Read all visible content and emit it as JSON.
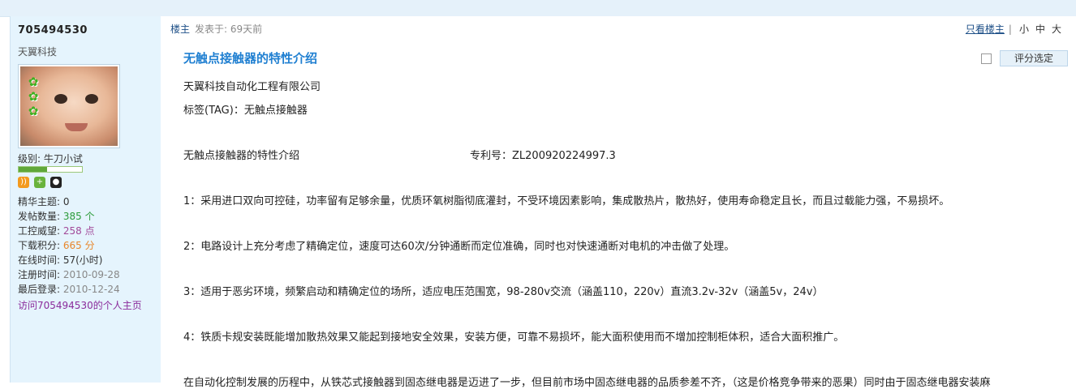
{
  "author": {
    "username": "705494530",
    "title": "天翼科技",
    "level_label": "级别: 牛刀小试",
    "level_progress_fraction": 0.45,
    "icons": [
      "rss-icon",
      "add-friend-icon",
      "qq-icon"
    ],
    "stats": [
      {
        "key": "精华主题: ",
        "value": "0",
        "color": "dark"
      },
      {
        "key": "发帖数量: ",
        "value": "385 个",
        "color": "green"
      },
      {
        "key": "工控威望: ",
        "value": "258 点",
        "color": "purple"
      },
      {
        "key": "下载积分: ",
        "value": "665 分",
        "color": "orange"
      },
      {
        "key": "在线时间: ",
        "value": "57(小时)",
        "color": "dark"
      },
      {
        "key": "注册时间: ",
        "value": "2010-09-28",
        "color": "gray"
      },
      {
        "key": "最后登录: ",
        "value": "2010-12-24",
        "color": "gray"
      }
    ],
    "homepage_link": "访问705494530的个人主页"
  },
  "post": {
    "floor": "楼主",
    "time": "发表于: 69天前",
    "view_only_author": "只看楼主",
    "font_small": "小",
    "font_medium": "中",
    "font_large": "大",
    "title": "无触点接触器的特性介绍",
    "rate_button": "评分选定",
    "company": "天翼科技自动化工程有限公司",
    "tag": "标签(TAG)：无触点接触器",
    "intro_title": "无触点接触器的特性介绍",
    "patent": "专利号：ZL200920224997.3",
    "p1": "1：采用进口双向可控硅，功率留有足够余量，优质环氧树脂彻底灌封，不受环境因素影响，集成散热片，散热好，使用寿命稳定且长，而且过载能力强，不易损坏。",
    "p2": "2：电路设计上充分考虑了精确定位，速度可达60次/分钟通断而定位准确，同时也对快速通断对电机的冲击做了处理。",
    "p3": "3：适用于恶劣环境，频繁启动和精确定位的场所，适应电压范围宽，98-280v交流（涵盖110，220v）直流3.2v-32v（涵盖5v，24v）",
    "p4": "4：铁质卡规安装既能增加散热效果又能起到接地安全效果，安装方便，可靠不易损坏，能大面积使用而不增加控制柜体积，适合大面积推广。",
    "p5": "在自动化控制发展的历程中，从铁芯式接触器到固态继电器是迈进了一步，但目前市场中固态继电器的品质参差不齐，（这是价格竞争带来的恶果）同时由于固态继电器安装麻"
  },
  "colors": {
    "sidebar_bg": "#e5f4fd",
    "title_blue": "#1f7fd1",
    "link_blue": "#1d4f87"
  }
}
